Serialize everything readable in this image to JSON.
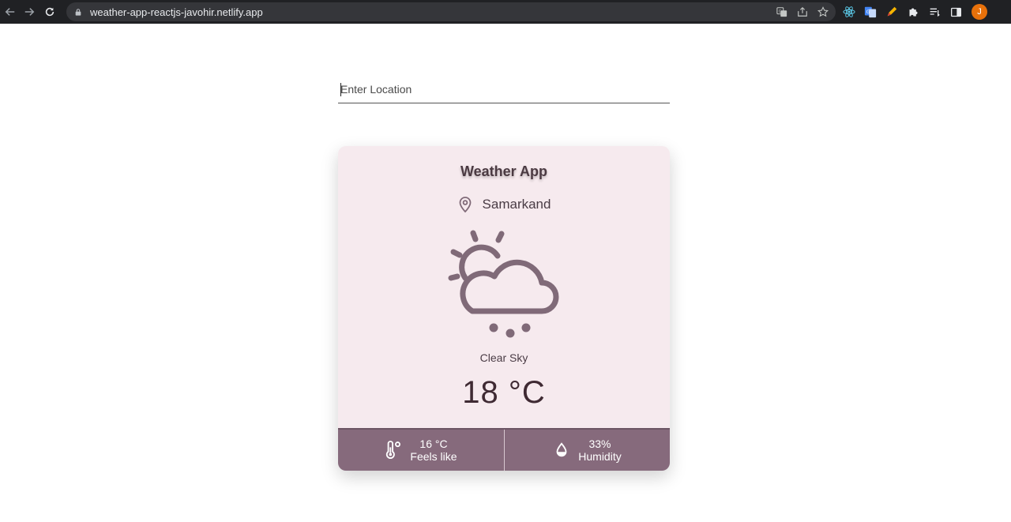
{
  "browser": {
    "url": "weather-app-reactjs-javohir.netlify.app",
    "profile_initial": "J",
    "nav_icons": [
      "back-icon",
      "forward-icon",
      "reload-icon"
    ],
    "omnibox_icons": [
      "translate-icon",
      "share-icon",
      "bookmark-star-icon"
    ],
    "extension_icons": [
      "react-devtools-icon",
      "translate-extension-icon",
      "pen-extension-icon",
      "extensions-puzzle-icon",
      "reading-list-icon",
      "side-panel-icon"
    ]
  },
  "search": {
    "placeholder": "Enter Location",
    "value": ""
  },
  "card": {
    "title": "Weather App",
    "location": "Samarkand",
    "weather_icon": "partly-cloudy-icon",
    "description": "Clear Sky",
    "temperature": "18 °C",
    "feels_like": {
      "value": "16 °C",
      "label": "Feels like",
      "icon": "thermometer-icon"
    },
    "humidity": {
      "value": "33%",
      "label": "Humidity",
      "icon": "drop-icon"
    }
  },
  "colors": {
    "card_bg": "#f6eaee",
    "footer_bg": "#866a7c",
    "icon": "#806a78",
    "temp_text": "#3f2a33"
  }
}
